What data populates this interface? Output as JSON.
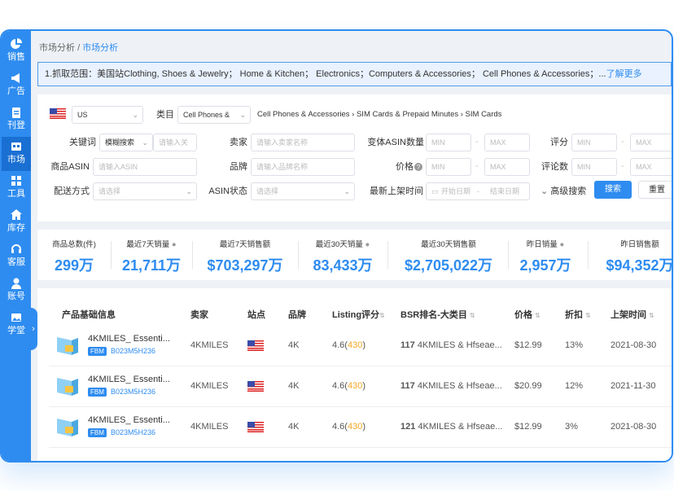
{
  "sidebar": {
    "items": [
      {
        "label": "销售",
        "icon": "pie-chart-icon"
      },
      {
        "label": "广告",
        "icon": "megaphone-icon"
      },
      {
        "label": "刊登",
        "icon": "clipboard-icon"
      },
      {
        "label": "市场",
        "icon": "market-icon"
      },
      {
        "label": "工具",
        "icon": "tools-icon"
      },
      {
        "label": "库存",
        "icon": "home-icon"
      },
      {
        "label": "客服",
        "icon": "headset-icon"
      },
      {
        "label": "账号",
        "icon": "user-icon"
      },
      {
        "label": "学堂",
        "icon": "image-icon"
      }
    ],
    "active": "市场",
    "collapse": "›"
  },
  "breadcrumb": {
    "parent": "市场分析",
    "sep": "/",
    "current": "市场分析"
  },
  "notice": {
    "text": "1.抓取范围：美国站Clothing, Shoes & Jewelry；  Home & Kitchen；  Electronics；Computers & Accessories；  Cell Phones & Accessories；...",
    "more": "了解更多"
  },
  "filters": {
    "country": "US",
    "category_label": "类目",
    "category_value": "Cell Phones &",
    "category_path": "Cell Phones & Accessories › SIM Cards & Prepaid Minutes › SIM Cards",
    "keyword_label": "关键词",
    "keyword_mode": "模糊搜索",
    "keyword_placeholder": "请输入关",
    "seller_label": "卖家",
    "seller_placeholder": "请输入卖家名称",
    "variant_label": "变体ASIN数量",
    "min": "MIN",
    "max": "MAX",
    "rating_label": "评分",
    "asin_label": "商品ASIN",
    "asin_placeholder": "请输入ASIN",
    "brand_label": "品牌",
    "brand_placeholder": "请输入品牌名称",
    "price_label": "价格",
    "reviews_label": "评论数",
    "ship_label": "配送方式",
    "select_placeholder": "请选择",
    "asin_status_label": "ASIN状态",
    "listed_label": "最新上架时间",
    "start_date": "开始日期",
    "end_date": "结束日期",
    "advanced": "高级搜索",
    "search": "搜索",
    "reset": "重置",
    "dash": "-"
  },
  "stats": [
    {
      "title": "商品总数(件)",
      "value": "299万"
    },
    {
      "title": "最近7天销量",
      "value": "21,711万"
    },
    {
      "title": "最近7天销售额",
      "value": "$703,297万"
    },
    {
      "title": "最近30天销量",
      "value": "83,433万"
    },
    {
      "title": "最近30天销售额",
      "value": "$2,705,022万"
    },
    {
      "title": "昨日销量",
      "value": "2,957万"
    },
    {
      "title": "昨日销售额",
      "value": "$94,352万"
    }
  ],
  "table": {
    "headers": {
      "product": "产品基础信息",
      "seller": "卖家",
      "site": "站点",
      "brand": "品牌",
      "listing": "Listing评分",
      "bsr": "BSR排名-大类目",
      "price": "价格",
      "discount": "折扣",
      "listed": "上架时间"
    },
    "rows": [
      {
        "name": "4KMILES_ Essenti...",
        "fbm": "FBM",
        "asin": "B023M5H236",
        "seller": "4KMILES",
        "brand": "4K",
        "score": "4.6",
        "score_count": "430",
        "bsr_rank": "117",
        "bsr_name": "4KMILES & Hfseae...",
        "price": "$12.99",
        "discount": "13%",
        "date": "2021-08-30"
      },
      {
        "name": "4KMILES_ Essenti...",
        "fbm": "FBM",
        "asin": "B023M5H236",
        "seller": "4KMILES",
        "brand": "4K",
        "score": "4.6",
        "score_count": "430",
        "bsr_rank": "117",
        "bsr_name": "4KMILES & Hfseae...",
        "price": "$20.99",
        "discount": "12%",
        "date": "2021-11-30"
      },
      {
        "name": "4KMILES_ Essenti...",
        "fbm": "FBM",
        "asin": "B023M5H236",
        "seller": "4KMILES",
        "brand": "4K",
        "score": "4.6",
        "score_count": "430",
        "bsr_rank": "121",
        "bsr_name": "4KMILES & Hfseae...",
        "price": "$12.99",
        "discount": "3%",
        "date": "2021-08-30"
      }
    ]
  },
  "colors": {
    "accent": "#2e8cf0",
    "orange": "#f5a623"
  }
}
